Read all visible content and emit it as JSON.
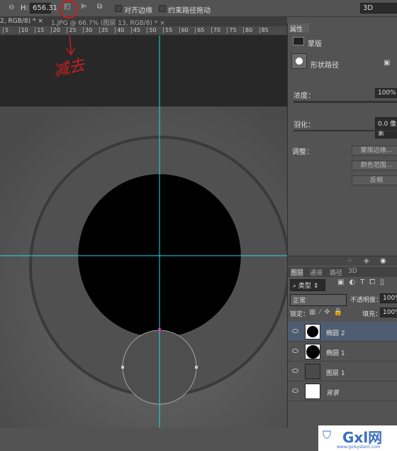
{
  "options": {
    "h_label": "H:",
    "h_value": "656.31",
    "align_edges": "对齐边缘",
    "constrain_path": "约束路径拖动",
    "workspace": "3D"
  },
  "tabs": [
    {
      "label": "2, RGB/8) *"
    },
    {
      "label": "1.JPG @ 66.7% (图层 13, RGB/8) *"
    }
  ],
  "ruler": [
    "5",
    "10",
    "15",
    "20",
    "25",
    "30",
    "35",
    "40",
    "45",
    "50",
    "55",
    "60",
    "65",
    "70",
    "75",
    "80",
    "85"
  ],
  "annotation": "减去",
  "properties": {
    "tab": "属性",
    "mask_label": "蒙版",
    "shape_path": "形状路径",
    "density_label": "浓度：",
    "density_value": "100%",
    "feather_label": "羽化：",
    "feather_value": "0.0 像素",
    "adjust_label": "调整：",
    "mask_edge": "蒙版边缘...",
    "color_range": "颜色范围...",
    "invert": "反相"
  },
  "layers_panel": {
    "tabs": [
      "图层",
      "通道",
      "路径",
      "3D"
    ],
    "filter": "类型",
    "blend_mode": "正常",
    "opacity_label": "不透明度：",
    "opacity_value": "100%",
    "lock_label": "锁定：",
    "fill_label": "填充：",
    "fill_value": "100%",
    "layers": [
      {
        "name": "椭圆 2",
        "selected": true
      },
      {
        "name": "椭圆 1"
      },
      {
        "name": "图层 1"
      },
      {
        "name": "背景"
      }
    ]
  },
  "watermark": {
    "text": "Gxl网",
    "url": "www.gxlsystem.com"
  },
  "colors": {
    "guide": "#2ad4e6",
    "selected_layer": "#4e5d72",
    "annotation": "#c81e1e"
  }
}
